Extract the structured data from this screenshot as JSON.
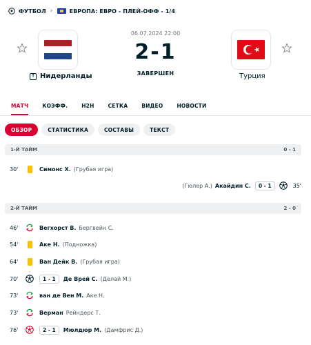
{
  "breadcrumb": {
    "sport": "ФУТБОЛ",
    "competition": "ЕВРОПА: ЕВРО - ПЛЕЙ-ОФФ - 1/4"
  },
  "match": {
    "date": "06.07.2024 22:00",
    "score": "2-1",
    "status": "ЗАВЕРШЕН",
    "home": {
      "name": "Нидерланды",
      "flag_colors": [
        "#ae1c28",
        "#ffffff",
        "#21468b"
      ]
    },
    "away": {
      "name": "Турция",
      "flag_color": "#e30a17"
    }
  },
  "tabs": [
    "МАТЧ",
    "КОЭФФ.",
    "H2H",
    "СЕТКА",
    "ВИДЕО",
    "НОВОСТИ"
  ],
  "active_tab": "МАТЧ",
  "subtabs": [
    "ОБЗОР",
    "СТАТИСТИКА",
    "СОСТАВЫ",
    "ТЕКСТ"
  ],
  "active_subtab": "ОБЗОР",
  "colors": {
    "accent": "#dc0032",
    "yellow_card": "#f7c200",
    "sub_in": "#16a34a",
    "sub_out": "#dc0032"
  },
  "sections": [
    {
      "title": "1-Й ТАЙМ",
      "score": "0 - 1",
      "events": [
        {
          "minute": "30'",
          "side": "home",
          "icon": "yellow-card-icon",
          "player": "Симонс Х.",
          "detail": "(Грубая игра)"
        },
        {
          "minute": "35'",
          "side": "away",
          "icon": "soccer-ball-icon",
          "score": "0 - 1",
          "player": "Акайдин С.",
          "detail": "(Гюлер А.)"
        }
      ]
    },
    {
      "title": "2-Й ТАЙМ",
      "score": "2 - 0",
      "events": [
        {
          "minute": "46'",
          "side": "home",
          "icon": "substitution-icon",
          "player": "Вегхорст В.",
          "detail": "Бергвейн С."
        },
        {
          "minute": "54'",
          "side": "home",
          "icon": "yellow-card-icon",
          "player": "Аке Н.",
          "detail": "(Подножка)"
        },
        {
          "minute": "64'",
          "side": "home",
          "icon": "yellow-card-icon",
          "player": "Ван Дейк В.",
          "detail": "(Грубая игра)"
        },
        {
          "minute": "70'",
          "side": "home",
          "icon": "soccer-ball-icon",
          "score": "1 - 1",
          "player": "Де Врей С.",
          "detail": "(Делай М.)"
        },
        {
          "minute": "73'",
          "side": "home",
          "icon": "substitution-icon",
          "player": "ван де Вен М.",
          "detail": "Аке Н."
        },
        {
          "minute": "73'",
          "side": "home",
          "icon": "substitution-icon",
          "player": "Верман",
          "detail": "Рейндерс Т."
        },
        {
          "minute": "76'",
          "side": "home",
          "icon": "own-goal-icon",
          "score": "2 - 1",
          "player": "Мюлдюр М.",
          "detail": "(Дамфрис Д.)"
        }
      ]
    }
  ]
}
